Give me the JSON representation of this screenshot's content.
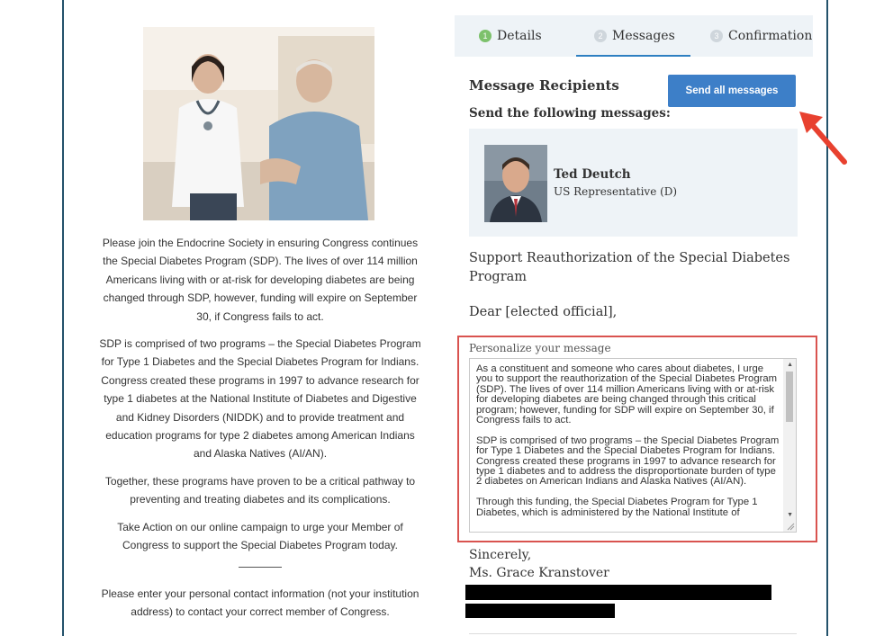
{
  "campaign": {
    "paragraphs": [
      "Please join the Endocrine Society in ensuring Congress continues the Special Diabetes Program (SDP). The lives of over 114 million Americans living with or at-risk for developing diabetes are being changed through SDP, however, funding will expire on September 30, if Congress fails to act.",
      "SDP is comprised of two programs – the Special Diabetes Program for Type 1 Diabetes and the Special Diabetes Program for Indians. Congress created these programs in 1997 to advance research for type 1 diabetes at the National Institute of Diabetes and Digestive and Kidney Disorders (NIDDK) and to provide treatment and education programs for type 2 diabetes among American Indians and Alaska Natives (AI/AN).",
      "Together, these programs have proven to be a critical pathway to preventing and treating diabetes and its complications.",
      "Take Action on our online campaign to urge your Member of Congress to support the Special Diabetes Program today.",
      "Please enter your personal contact information (not your institution address) to contact your correct member of Congress."
    ]
  },
  "steps": [
    {
      "number": "1",
      "label": "Details",
      "state": "complete"
    },
    {
      "number": "2",
      "label": "Messages",
      "state": "active"
    },
    {
      "number": "3",
      "label": "Confirmation",
      "state": "pending"
    }
  ],
  "recipients": {
    "title": "Message Recipients",
    "subtitle": "Send the following messages:",
    "send_button": "Send all messages",
    "rep_name": "Ted Deutch",
    "rep_title": "US Representative (D)"
  },
  "message": {
    "subject": "Support Reauthorization of the Special Diabetes Program",
    "greeting": "Dear [elected official],",
    "personalize_label": "Personalize your message",
    "body": "As a constituent and someone who cares about diabetes, I urge you to support the reauthorization of the Special Diabetes Program (SDP). The lives of over 114 million Americans living with or at-risk for developing diabetes are being changed through this critical program; however, funding for SDP will expire on September 30, if Congress fails to act.\n\nSDP is comprised of two programs – the Special Diabetes Program for Type 1 Diabetes and the Special Diabetes Program for Indians. Congress created these programs in 1997 to advance research for type 1 diabetes and to address the disproportionate burden of type 2 diabetes on American Indians and Alaska Natives (AI/AN).\n\nThrough this funding, the Special Diabetes Program for Type 1 Diabetes, which is administered by the National Institute of",
    "closing": "Sincerely,",
    "sender": "Ms. Grace Kranstover"
  },
  "colors": {
    "accent": "#3d7fc8",
    "step_complete": "#7dc16c",
    "highlight_border": "#d9534f",
    "annotation_arrow": "#e8412f"
  }
}
